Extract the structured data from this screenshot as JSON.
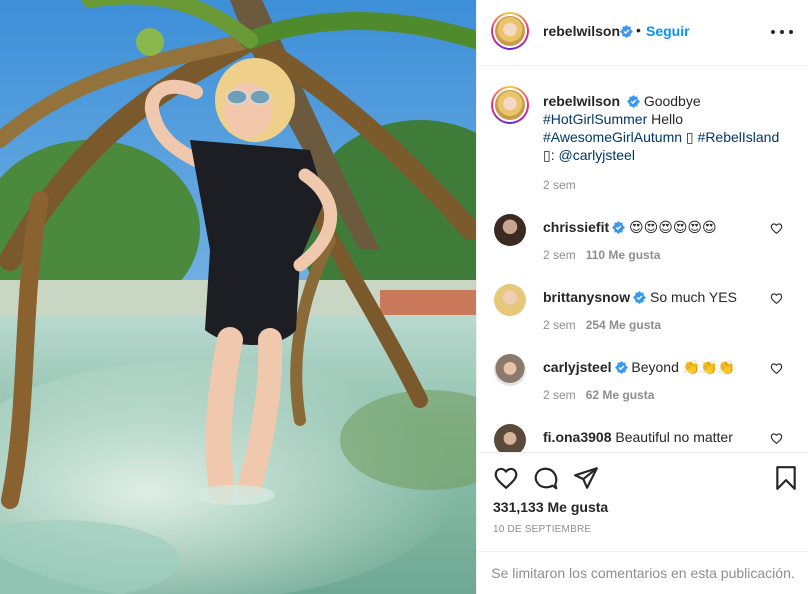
{
  "post": {
    "username": "rebelwilson",
    "follow_label": "Seguir",
    "separator": "•"
  },
  "caption": {
    "word1": "Goodbye",
    "hashtag1": "#HotGirlSummer",
    "word2": "Hello",
    "hashtag2": "#AwesomeGirlAutumn",
    "emoji1": "▯",
    "hashtag3": "#RebelIsland",
    "emoji2": "▯",
    "credit_prefix": ":",
    "mention": "@carlyjsteel",
    "time": "2 sem"
  },
  "comments": [
    {
      "username": "chrissiefit",
      "verified": true,
      "text": "😍😍😍😍😍😍",
      "time": "2 sem",
      "likes": "110 Me gusta"
    },
    {
      "username": "brittanysnow",
      "verified": true,
      "text": "So much YES",
      "time": "2 sem",
      "likes": "254 Me gusta"
    },
    {
      "username": "carlyjsteel",
      "verified": true,
      "text": "Beyond 👏👏👏",
      "time": "2 sem",
      "likes": "62 Me gusta"
    },
    {
      "username": "fi.ona3908",
      "verified": false,
      "text": "Beautiful no matter",
      "time": "",
      "likes": ""
    }
  ],
  "footer": {
    "likes_count": "331,133 Me gusta",
    "date": "10 DE SEPTIEMBRE",
    "comments_limited": "Se limitaron los comentarios en esta publicación."
  },
  "colors": {
    "link_blue": "#0095f6",
    "hashtag": "#00376b",
    "muted": "#8e8e8e",
    "border": "#efefef",
    "verified": "#3897f0"
  },
  "icons": [
    "verified-badge-icon",
    "more-options-icon",
    "heart-icon",
    "comment-icon",
    "share-icon",
    "bookmark-icon"
  ]
}
